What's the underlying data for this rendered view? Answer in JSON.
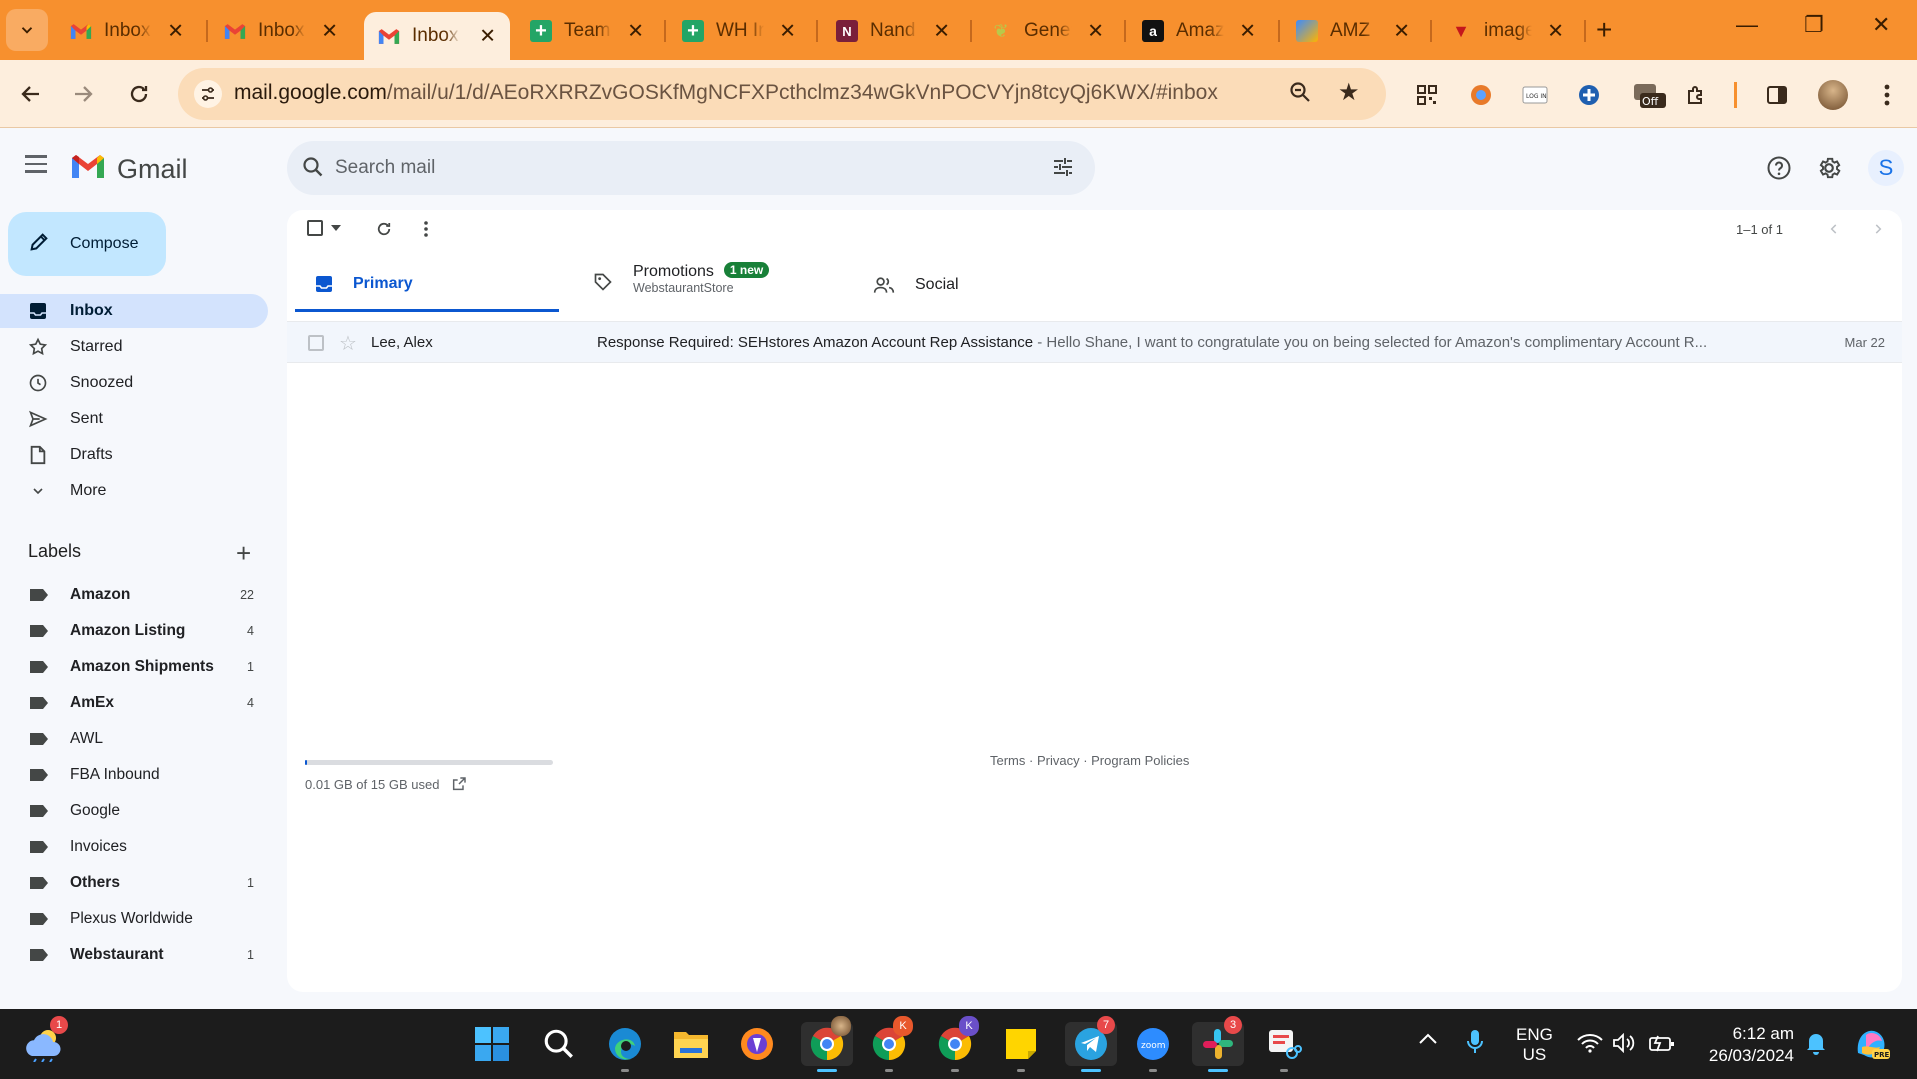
{
  "browser": {
    "tabs": [
      {
        "title": "Inbox",
        "favicon": "gmail"
      },
      {
        "title": "Inbox",
        "favicon": "gmail"
      },
      {
        "title": "Inbox",
        "favicon": "gmail"
      },
      {
        "title": "Team",
        "favicon": "sheets"
      },
      {
        "title": "WH Ir",
        "favicon": "sheets"
      },
      {
        "title": "Nand",
        "favicon": "nandini"
      },
      {
        "title": "Gener",
        "favicon": "leaf"
      },
      {
        "title": "Amaz",
        "favicon": "amazon"
      },
      {
        "title": "AMZ",
        "favicon": "amz"
      },
      {
        "title": "image",
        "favicon": "image"
      }
    ],
    "active_tab": 2,
    "url_host": "mail.google.com",
    "url_path": "/mail/u/1/d/AEoRXRRZvGOSKfMgNCFXPcthclmz34wGkVnPOCVYjn8tcyQj6KWX/#inbox",
    "extension_off_label": "Off"
  },
  "gmail": {
    "logo_text": "Gmail",
    "search_placeholder": "Search mail",
    "avatar_letter": "S",
    "compose_label": "Compose",
    "nav": [
      {
        "label": "Inbox",
        "icon": "inbox-icon",
        "active": true
      },
      {
        "label": "Starred",
        "icon": "star-icon"
      },
      {
        "label": "Snoozed",
        "icon": "clock-icon"
      },
      {
        "label": "Sent",
        "icon": "send-icon"
      },
      {
        "label": "Drafts",
        "icon": "draft-icon"
      },
      {
        "label": "More",
        "icon": "chevron-down-icon"
      }
    ],
    "labels_title": "Labels",
    "labels": [
      {
        "name": "Amazon",
        "count": "22",
        "bold": true
      },
      {
        "name": "Amazon Listing",
        "count": "4",
        "bold": true
      },
      {
        "name": "Amazon Shipments",
        "count": "1",
        "bold": true
      },
      {
        "name": "AmEx",
        "count": "4",
        "bold": true
      },
      {
        "name": "AWL",
        "count": "",
        "bold": false
      },
      {
        "name": "FBA Inbound",
        "count": "",
        "bold": false
      },
      {
        "name": "Google",
        "count": "",
        "bold": false
      },
      {
        "name": "Invoices",
        "count": "",
        "bold": false
      },
      {
        "name": "Others",
        "count": "1",
        "bold": true
      },
      {
        "name": "Plexus Worldwide",
        "count": "",
        "bold": false
      },
      {
        "name": "Webstaurant",
        "count": "1",
        "bold": true
      }
    ],
    "pager": "1–1 of 1",
    "categories": [
      {
        "label": "Primary",
        "active": true
      },
      {
        "label": "Promotions",
        "badge": "1 new",
        "sub": "WebstaurantStore"
      },
      {
        "label": "Social"
      }
    ],
    "emails": [
      {
        "sender": "Lee, Alex",
        "subject": "Response Required: SEHstores Amazon Account Rep Assistance",
        "snippet": " - Hello Shane, I want to congratulate you on being selected for Amazon's complimentary Account R...",
        "date": "Mar 22"
      }
    ],
    "storage": "0.01 GB of 15 GB used",
    "storage_fraction": 0.001,
    "footer": {
      "terms": "Terms",
      "privacy": "Privacy",
      "policies": "Program Policies",
      "sep": " · "
    }
  },
  "taskbar": {
    "weather_badge": "1",
    "chrome2_badge": "K",
    "chrome3_badge": "K",
    "telegram_badge": "7",
    "slack_badge": "3",
    "zoom_label": "zoom",
    "lang_line1": "ENG",
    "lang_line2": "US",
    "time": "6:12 am",
    "date": "26/03/2024"
  },
  "colors": {
    "chrome_orange": "#f7902e",
    "toolbar": "#fdeedd",
    "gmail_active_nav": "#d3e3fd",
    "compose": "#c2e7ff",
    "primary_blue": "#0b57d0",
    "new_badge": "#188038"
  }
}
